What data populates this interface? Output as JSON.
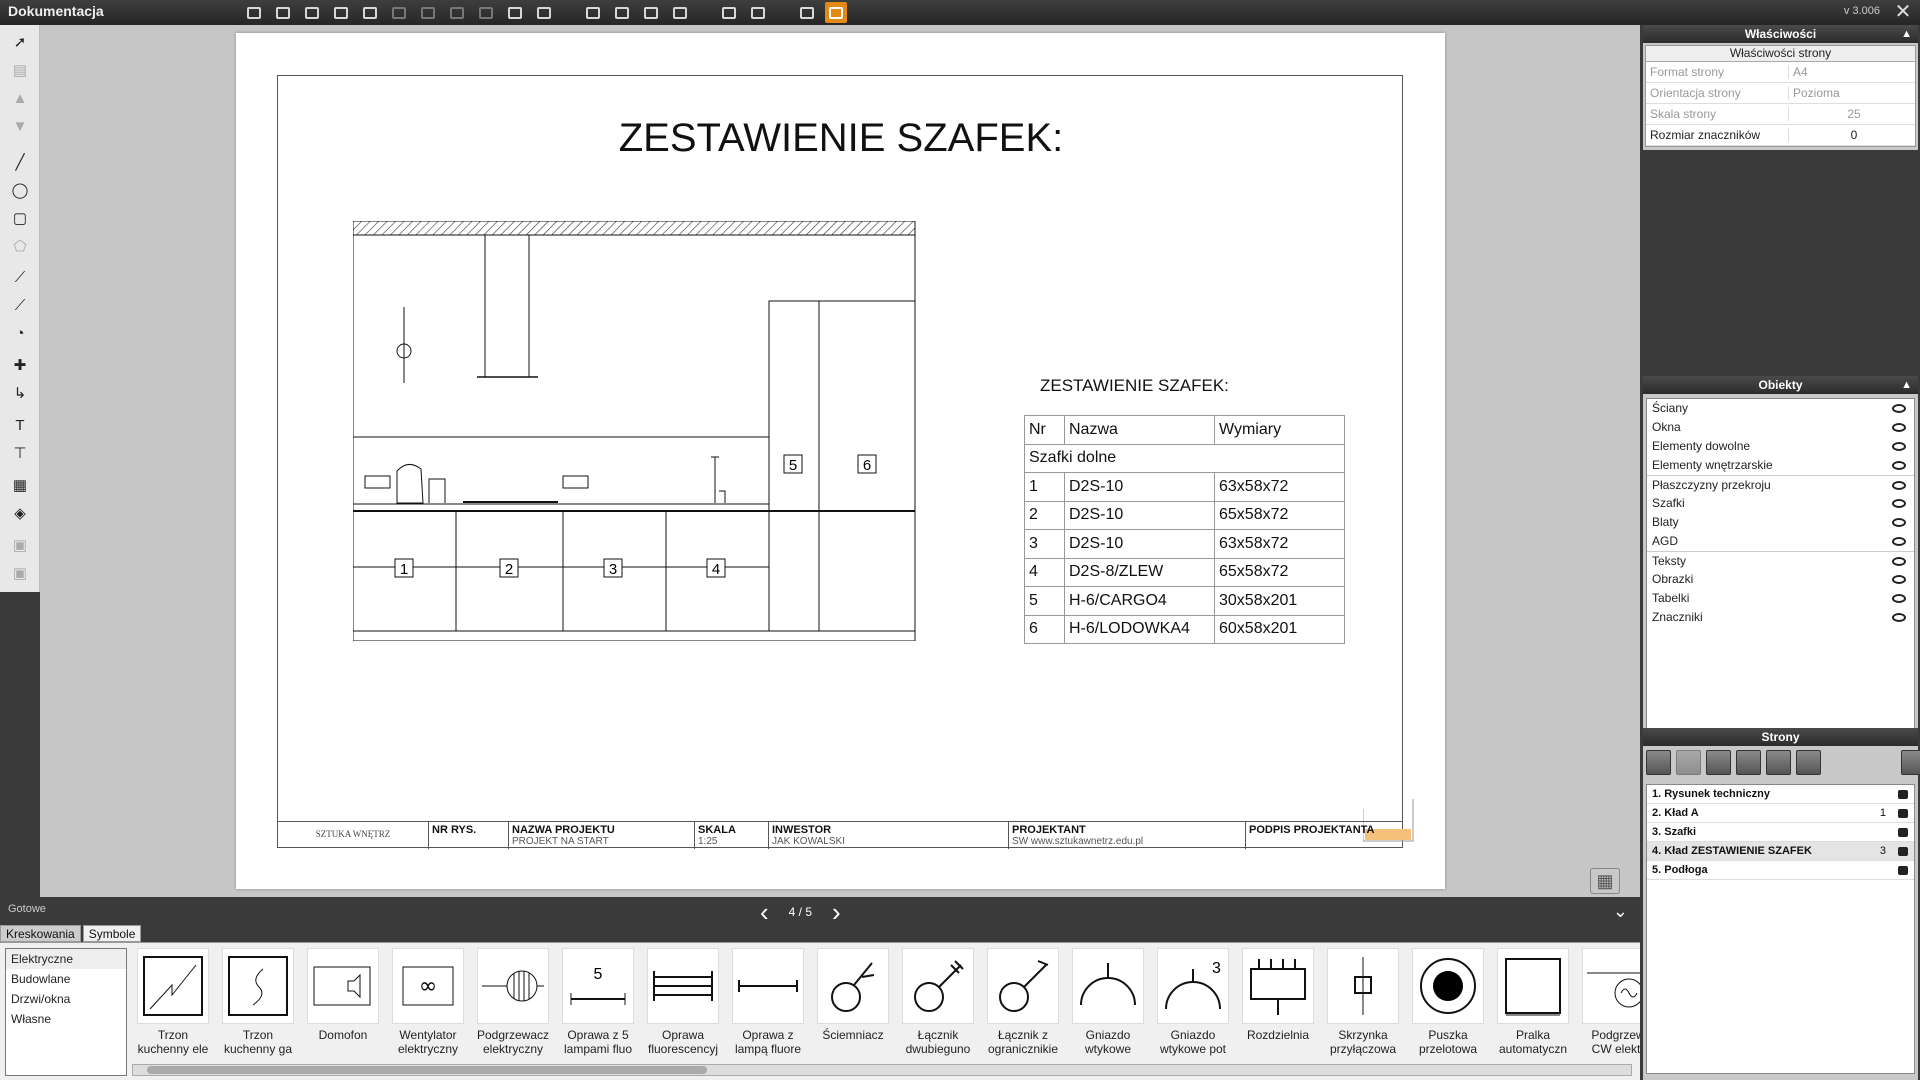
{
  "app": {
    "title": "Dokumentacja",
    "version": "v 3.006"
  },
  "toolbar": {
    "icons": [
      "save-icon",
      "save-as-icon",
      "print-icon",
      "export-icon",
      "undo-icon",
      "redo-icon",
      "copy-icon",
      "paste-icon",
      "cut-icon",
      "delete-icon",
      "settings-icon",
      "line-tool-icon",
      "shape-tool-icon",
      "mirror-icon",
      "align-icon",
      "dimension-icon",
      "measure-icon",
      "view-icon",
      "orange-view-icon"
    ]
  },
  "document": {
    "title": "ZESTAWIENIE SZAFEK:",
    "table_title": "ZESTAWIENIE SZAFEK:",
    "table": {
      "headers": [
        "Nr",
        "Nazwa",
        "Wymiary"
      ],
      "group": "Szafki dolne",
      "rows": [
        [
          "1",
          "D2S-10",
          "63x58x72"
        ],
        [
          "2",
          "D2S-10",
          "65x58x72"
        ],
        [
          "3",
          "D2S-10",
          "63x58x72"
        ],
        [
          "4",
          "D2S-8/ZLEW",
          "65x58x72"
        ],
        [
          "5",
          "H-6/CARGO4",
          "30x58x201"
        ],
        [
          "6",
          "H-6/LODOWKA4",
          "60x58x201"
        ]
      ]
    },
    "cabinet_labels": [
      "1",
      "2",
      "3",
      "4",
      "5",
      "6"
    ],
    "titleblock": {
      "logo": "SZTUKA WNĘTRZ",
      "nr_label": "NR RYS.",
      "project_label": "NAZWA PROJEKTU",
      "project_value": "PROJEKT NA START",
      "scale_label": "SKALA",
      "scale_value": "1:25",
      "investor_label": "INWESTOR",
      "investor_value": "JAK KOWALSKI",
      "designer_label": "PROJEKTANT",
      "designer_value": "SW www.sztukawnetrz.edu.pl",
      "signature_label": "PODPIS PROJEKTANTA"
    }
  },
  "status": {
    "text": "Gotowe",
    "page": "4 / 5"
  },
  "bottom": {
    "tabs": [
      "Kreskowania",
      "Symbole"
    ],
    "categories": [
      "Elektryczne",
      "Budowlane",
      "Drzwi/okna",
      "Własne"
    ],
    "symbols": [
      {
        "label1": "Trzon",
        "label2": "kuchenny ele"
      },
      {
        "label1": "Trzon",
        "label2": "kuchenny ga"
      },
      {
        "label1": "Domofon",
        "label2": ""
      },
      {
        "label1": "Wentylator",
        "label2": "elektryczny"
      },
      {
        "label1": "Podgrzewacz",
        "label2": "elektryczny"
      },
      {
        "label1": "Oprawa z 5",
        "label2": "lampami fluo"
      },
      {
        "label1": "Oprawa",
        "label2": "fluorescencyj"
      },
      {
        "label1": "Oprawa z",
        "label2": "lampą fluore"
      },
      {
        "label1": "Ściemniacz",
        "label2": ""
      },
      {
        "label1": "Łącznik",
        "label2": "dwubiegunо"
      },
      {
        "label1": "Łącznik z",
        "label2": "ogranicznikie"
      },
      {
        "label1": "Gniazdo",
        "label2": "wtykowe"
      },
      {
        "label1": "Gniazdo",
        "label2": "wtykowe pot"
      },
      {
        "label1": "Rozdzielnia",
        "label2": ""
      },
      {
        "label1": "Skrzynka",
        "label2": "przyłączowa"
      },
      {
        "label1": "Puszka",
        "label2": "przelotowa"
      },
      {
        "label1": "Pralka",
        "label2": "automatyczn"
      },
      {
        "label1": "Podgrzew",
        "label2": "CW elektr"
      }
    ],
    "symbol_numbers": {
      "fluo5": "5",
      "socket3": "3"
    }
  },
  "properties": {
    "header": "Właściwości",
    "sub": "Właściwości strony",
    "rows": [
      {
        "key": "Format strony",
        "value": "A4"
      },
      {
        "key": "Orientacja strony",
        "value": "Pozioma"
      },
      {
        "key": "Skala strony",
        "value": "25"
      },
      {
        "key": "Rozmiar znaczników",
        "value": "0"
      }
    ]
  },
  "objects": {
    "header": "Obiekty",
    "items": [
      "Ściany",
      "Okna",
      "Elementy dowolne",
      "Elementy wnętrzarskie",
      "Płaszczyzny przekroju",
      "Szafki",
      "Blaty",
      "AGD",
      "Teksty",
      "Obrazki",
      "Tabelki",
      "Znaczniki"
    ]
  },
  "pages": {
    "header": "Strony",
    "items": [
      {
        "label": "1. Rysunek techniczny",
        "extra": ""
      },
      {
        "label": "2. Kład A",
        "extra": "1"
      },
      {
        "label": "3. Szafki",
        "extra": ""
      },
      {
        "label": "4. Kład ZESTAWIENIE SZAFEK",
        "extra": "3"
      },
      {
        "label": "5. Podłoga",
        "extra": ""
      }
    ]
  }
}
